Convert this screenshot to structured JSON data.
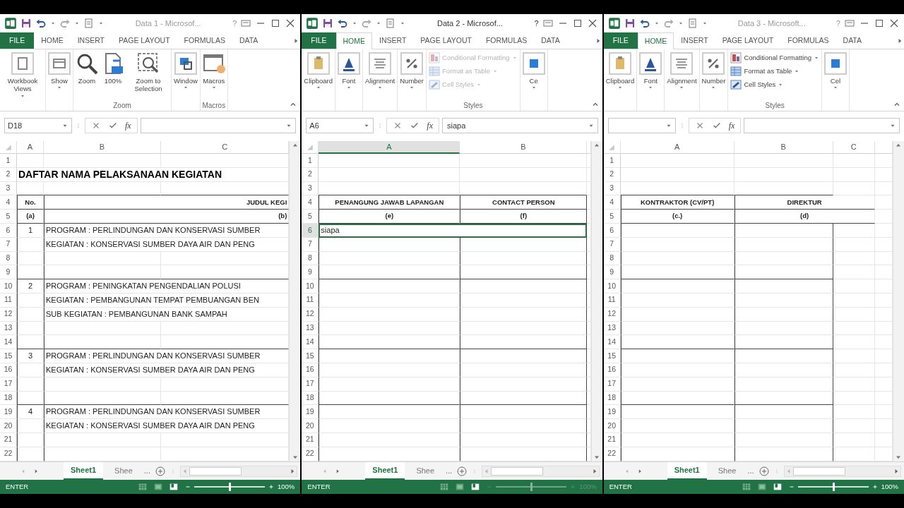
{
  "windows": [
    {
      "active": false,
      "title": "Data 1 - Microsof...",
      "help": "?",
      "tabs": [
        {
          "label": "FILE",
          "kind": "file",
          "selected": false
        },
        {
          "label": "HOME",
          "kind": "tab",
          "selected": false
        },
        {
          "label": "INSERT",
          "kind": "tab",
          "selected": false
        },
        {
          "label": "PAGE LAYOUT",
          "kind": "tab",
          "selected": false
        },
        {
          "label": "FORMULAS",
          "kind": "tab",
          "selected": false
        },
        {
          "label": "DATA",
          "kind": "tab",
          "selected": false
        }
      ],
      "ribbon": {
        "groups": [
          {
            "items": [
              {
                "kind": "large",
                "label": "Workbook Views",
                "dropdown": true,
                "disabled": false
              }
            ]
          },
          {
            "items": [
              {
                "kind": "large",
                "label": "Show",
                "dropdown": true,
                "disabled": false
              }
            ]
          },
          {
            "label": "Zoom",
            "items": [
              {
                "kind": "large",
                "label": "Zoom",
                "dropdown": false,
                "disabled": false
              },
              {
                "kind": "large",
                "label": "100%",
                "dropdown": false,
                "disabled": false
              },
              {
                "kind": "large",
                "label": "Zoom to Selection",
                "dropdown": false,
                "disabled": false
              }
            ]
          },
          {
            "items": [
              {
                "kind": "large",
                "label": "Window",
                "dropdown": true,
                "disabled": false
              }
            ]
          },
          {
            "label": "Macros",
            "items": [
              {
                "kind": "large",
                "label": "Macros",
                "dropdown": true,
                "disabled": false
              }
            ]
          }
        ]
      },
      "formula_bar": {
        "name_box": "D18",
        "function_label": "fx"
      },
      "columns": [
        {
          "label": "A",
          "selected": false
        },
        {
          "label": "B",
          "selected": false
        },
        {
          "label": "C",
          "selected": false
        }
      ],
      "table_closed": false,
      "rows": [
        {
          "number": "1",
          "selected": false
        },
        {
          "number": "2",
          "selected": false,
          "cells": [
            {
              "text": "DAFTAR NAMA PELAKSANAAN KEGIATAN",
              "kind": "title"
            },
            null,
            null
          ]
        },
        {
          "number": "3",
          "selected": false,
          "rule": true
        },
        {
          "number": "4",
          "selected": false,
          "rule": true,
          "boxed": true,
          "cells": [
            {
              "text": "No.",
              "kind": "heading"
            },
            {
              "text": "JUDUL KEGI",
              "kind": "heading-end"
            },
            null
          ]
        },
        {
          "number": "5",
          "selected": false,
          "rule": true,
          "boxed": true,
          "cells": [
            {
              "text": "(a)",
              "kind": "heading"
            },
            {
              "text": "(b)",
              "kind": "heading-end"
            },
            null
          ]
        },
        {
          "number": "6",
          "selected": false,
          "boxed": true,
          "cells": [
            {
              "text": "1",
              "kind": "index"
            },
            {
              "text": "PROGRAM : PERLINDUNGAN DAN KONSERVASI SUMBER",
              "kind": "text"
            },
            null
          ]
        },
        {
          "number": "7",
          "selected": false,
          "boxed": true,
          "cells": [
            null,
            {
              "text": "KEGIATAN : KONSERVASI SUMBER DAYA AIR DAN PENG",
              "kind": "text"
            },
            null
          ]
        },
        {
          "number": "8",
          "selected": false,
          "boxed": true
        },
        {
          "number": "9",
          "selected": false,
          "boxed": true,
          "rule": true
        },
        {
          "number": "10",
          "selected": false,
          "boxed": true,
          "cells": [
            {
              "text": "2",
              "kind": "index"
            },
            {
              "text": "PROGRAM : PENINGKATAN PENGENDALIAN POLUSI",
              "kind": "text"
            },
            null
          ]
        },
        {
          "number": "11",
          "selected": false,
          "boxed": true,
          "cells": [
            null,
            {
              "text": "KEGIATAN : PEMBANGUNAN TEMPAT PEMBUANGAN BEN",
              "kind": "text"
            },
            null
          ]
        },
        {
          "number": "12",
          "selected": false,
          "boxed": true,
          "cells": [
            null,
            {
              "text": "SUB KEGIATAN : PEMBANGUNAN BANK SAMPAH",
              "kind": "text"
            },
            null
          ]
        },
        {
          "number": "13",
          "selected": false,
          "boxed": true
        },
        {
          "number": "14",
          "selected": false,
          "boxed": true,
          "rule": true
        },
        {
          "number": "15",
          "selected": false,
          "boxed": true,
          "cells": [
            {
              "text": "3",
              "kind": "index"
            },
            {
              "text": "PROGRAM : PERLINDUNGAN DAN KONSERVASI SUMBER",
              "kind": "text"
            },
            null
          ]
        },
        {
          "number": "16",
          "selected": false,
          "boxed": true,
          "cells": [
            null,
            {
              "text": "KEGIATAN : KONSERVASI SUMBER DAYA AIR DAN PENG",
              "kind": "text"
            },
            null
          ]
        },
        {
          "number": "17",
          "selected": false,
          "boxed": true
        },
        {
          "number": "18",
          "selected": false,
          "boxed": true,
          "rule": true
        },
        {
          "number": "19",
          "selected": false,
          "boxed": true,
          "cells": [
            {
              "text": "4",
              "kind": "index"
            },
            {
              "text": "PROGRAM : PERLINDUNGAN DAN KONSERVASI SUMBER",
              "kind": "text"
            },
            null
          ]
        },
        {
          "number": "20",
          "selected": false,
          "boxed": true,
          "cells": [
            null,
            {
              "text": "KEGIATAN : KONSERVASI SUMBER DAYA AIR DAN PENG",
              "kind": "text"
            },
            null
          ]
        },
        {
          "number": "21",
          "selected": false,
          "boxed": true
        },
        {
          "number": "22",
          "selected": false,
          "boxed": true
        }
      ],
      "sheet_tabs": [
        {
          "label": "Sheet1",
          "selected": true
        },
        {
          "label": "Shee",
          "selected": false
        }
      ],
      "more_sheets": "...",
      "status": {
        "mode": "ENTER",
        "zoom": {
          "level": 0.5,
          "disabled": false
        },
        "zoom_label": "100%"
      }
    },
    {
      "active": true,
      "title": "Data 2 - Microsof...",
      "help": "?",
      "tabs": [
        {
          "label": "FILE",
          "kind": "file",
          "selected": false
        },
        {
          "label": "HOME",
          "kind": "tab",
          "selected": true
        },
        {
          "label": "INSERT",
          "kind": "tab",
          "selected": false
        },
        {
          "label": "PAGE LAYOUT",
          "kind": "tab",
          "selected": false
        },
        {
          "label": "FORMULAS",
          "kind": "tab",
          "selected": false
        },
        {
          "label": "DATA",
          "kind": "tab",
          "selected": false
        }
      ],
      "ribbon": {
        "groups": [
          {
            "items": [
              {
                "kind": "large",
                "label": "Clipboard",
                "dropdown": true,
                "disabled": false
              }
            ]
          },
          {
            "items": [
              {
                "kind": "large",
                "label": "Font",
                "dropdown": true,
                "disabled": false
              }
            ]
          },
          {
            "items": [
              {
                "kind": "large",
                "label": "Alignment",
                "dropdown": true,
                "disabled": false
              }
            ]
          },
          {
            "items": [
              {
                "kind": "large",
                "label": "Number",
                "dropdown": true,
                "disabled": false
              }
            ]
          },
          {
            "label": "Styles",
            "items": [
              {
                "kind": "small",
                "label": "Conditional Formatting",
                "dropdown": true,
                "disabled": true
              },
              {
                "kind": "small",
                "label": "Format as Table",
                "dropdown": true,
                "disabled": true
              },
              {
                "kind": "small",
                "label": "Cell Styles",
                "dropdown": true,
                "disabled": true
              }
            ]
          },
          {
            "items": [
              {
                "kind": "large",
                "label": "Ce",
                "dropdown": true,
                "disabled": false
              }
            ]
          }
        ]
      },
      "formula_bar": {
        "name_box": "A6",
        "function_label": "fx",
        "value": "siapa"
      },
      "columns": [
        {
          "label": "A",
          "selected": true
        },
        {
          "label": "B",
          "selected": false
        }
      ],
      "table_closed": true,
      "rows": [
        {
          "number": "1",
          "selected": false
        },
        {
          "number": "2",
          "selected": false
        },
        {
          "number": "3",
          "selected": false,
          "rule": true
        },
        {
          "number": "4",
          "selected": false,
          "rule": true,
          "boxed": true,
          "cells": [
            {
              "text": "PENANGUNG JAWAB LAPANGAN",
              "kind": "heading"
            },
            {
              "text": "CONTACT PERSON",
              "kind": "heading"
            }
          ]
        },
        {
          "number": "5",
          "selected": false,
          "rule": true,
          "boxed": true,
          "cells": [
            {
              "text": "(e)",
              "kind": "heading"
            },
            {
              "text": "(f)",
              "kind": "heading"
            }
          ]
        },
        {
          "number": "6",
          "selected": true,
          "boxed": true,
          "cells": [
            {
              "text": "siapa",
              "kind": "text",
              "active": true
            },
            null
          ]
        },
        {
          "number": "7",
          "selected": false,
          "boxed": true
        },
        {
          "number": "8",
          "selected": false,
          "boxed": true
        },
        {
          "number": "9",
          "selected": false,
          "boxed": true,
          "rule": true
        },
        {
          "number": "10",
          "selected": false,
          "boxed": true
        },
        {
          "number": "11",
          "selected": false,
          "boxed": true
        },
        {
          "number": "12",
          "selected": false,
          "boxed": true
        },
        {
          "number": "13",
          "selected": false,
          "boxed": true
        },
        {
          "number": "14",
          "selected": false,
          "boxed": true,
          "rule": true
        },
        {
          "number": "15",
          "selected": false,
          "boxed": true
        },
        {
          "number": "16",
          "selected": false,
          "boxed": true
        },
        {
          "number": "17",
          "selected": false,
          "boxed": true
        },
        {
          "number": "18",
          "selected": false,
          "boxed": true,
          "rule": true
        },
        {
          "number": "19",
          "selected": false,
          "boxed": true
        },
        {
          "number": "20",
          "selected": false,
          "boxed": true
        },
        {
          "number": "21",
          "selected": false,
          "boxed": true
        },
        {
          "number": "22",
          "selected": false,
          "boxed": true
        }
      ],
      "sheet_tabs": [
        {
          "label": "Sheet1",
          "selected": true
        },
        {
          "label": "Shee",
          "selected": false
        }
      ],
      "more_sheets": "...",
      "status": {
        "mode": "ENTER",
        "zoom": {
          "level": 0.5,
          "disabled": true
        },
        "zoom_label": "100%"
      }
    },
    {
      "active": false,
      "title": "Data 3 - Microsoft...",
      "help": "?",
      "tabs": [
        {
          "label": "FILE",
          "kind": "file",
          "selected": false
        },
        {
          "label": "HOME",
          "kind": "tab",
          "selected": true
        },
        {
          "label": "INSERT",
          "kind": "tab",
          "selected": false
        },
        {
          "label": "PAGE LAYOUT",
          "kind": "tab",
          "selected": false
        },
        {
          "label": "FORMULAS",
          "kind": "tab",
          "selected": false
        },
        {
          "label": "DATA",
          "kind": "tab",
          "selected": false
        }
      ],
      "ribbon": {
        "groups": [
          {
            "items": [
              {
                "kind": "large",
                "label": "Clipboard",
                "dropdown": true,
                "disabled": false
              }
            ]
          },
          {
            "items": [
              {
                "kind": "large",
                "label": "Font",
                "dropdown": true,
                "disabled": false
              }
            ]
          },
          {
            "items": [
              {
                "kind": "large",
                "label": "Alignment",
                "dropdown": true,
                "disabled": false
              }
            ]
          },
          {
            "items": [
              {
                "kind": "large",
                "label": "Number",
                "dropdown": true,
                "disabled": false
              }
            ]
          },
          {
            "label": "Styles",
            "items": [
              {
                "kind": "small",
                "label": "Conditional Formatting",
                "dropdown": true,
                "disabled": false
              },
              {
                "kind": "small",
                "label": "Format as Table",
                "dropdown": true,
                "disabled": false
              },
              {
                "kind": "small",
                "label": "Cell Styles",
                "dropdown": true,
                "disabled": false
              }
            ]
          },
          {
            "items": [
              {
                "kind": "large",
                "label": "Cel",
                "dropdown": true,
                "disabled": false
              }
            ]
          }
        ]
      },
      "formula_bar": {
        "function_label": "fx"
      },
      "columns": [
        {
          "label": "A",
          "selected": false
        },
        {
          "label": "B",
          "selected": false
        },
        {
          "label": "C",
          "selected": false
        }
      ],
      "table_closed": true,
      "rows": [
        {
          "number": "1",
          "selected": false
        },
        {
          "number": "2",
          "selected": false
        },
        {
          "number": "3",
          "selected": false,
          "rule": true
        },
        {
          "number": "4",
          "selected": false,
          "rule": true,
          "boxed": true,
          "cells": [
            {
              "text": "KONTRAKTOR (CV/PT)",
              "kind": "heading"
            },
            {
              "text": "DIREKTUR",
              "kind": "heading"
            },
            null
          ]
        },
        {
          "number": "5",
          "selected": false,
          "rule": true,
          "boxed": true,
          "cells": [
            {
              "text": "(c.)",
              "kind": "heading"
            },
            {
              "text": "(d)",
              "kind": "heading"
            },
            null
          ]
        },
        {
          "number": "6",
          "selected": false,
          "boxed": true
        },
        {
          "number": "7",
          "selected": false,
          "boxed": true
        },
        {
          "number": "8",
          "selected": false,
          "boxed": true
        },
        {
          "number": "9",
          "selected": false,
          "boxed": true,
          "rule": true
        },
        {
          "number": "10",
          "selected": false,
          "boxed": true
        },
        {
          "number": "11",
          "selected": false,
          "boxed": true
        },
        {
          "number": "12",
          "selected": false,
          "boxed": true
        },
        {
          "number": "13",
          "selected": false,
          "boxed": true
        },
        {
          "number": "14",
          "selected": false,
          "boxed": true,
          "rule": true
        },
        {
          "number": "15",
          "selected": false,
          "boxed": true
        },
        {
          "number": "16",
          "selected": false,
          "boxed": true
        },
        {
          "number": "17",
          "selected": false,
          "boxed": true
        },
        {
          "number": "18",
          "selected": false,
          "boxed": true,
          "rule": true
        },
        {
          "number": "19",
          "selected": false,
          "boxed": true
        },
        {
          "number": "20",
          "selected": false,
          "boxed": true
        },
        {
          "number": "21",
          "selected": false,
          "boxed": true
        },
        {
          "number": "22",
          "selected": false,
          "boxed": true
        }
      ],
      "sheet_tabs": [
        {
          "label": "Sheet1",
          "selected": true
        },
        {
          "label": "Shee",
          "selected": false
        }
      ],
      "more_sheets": "...",
      "status": {
        "mode": "ENTER",
        "zoom": {
          "level": 0.5,
          "disabled": false
        },
        "zoom_label": "100%"
      }
    }
  ]
}
